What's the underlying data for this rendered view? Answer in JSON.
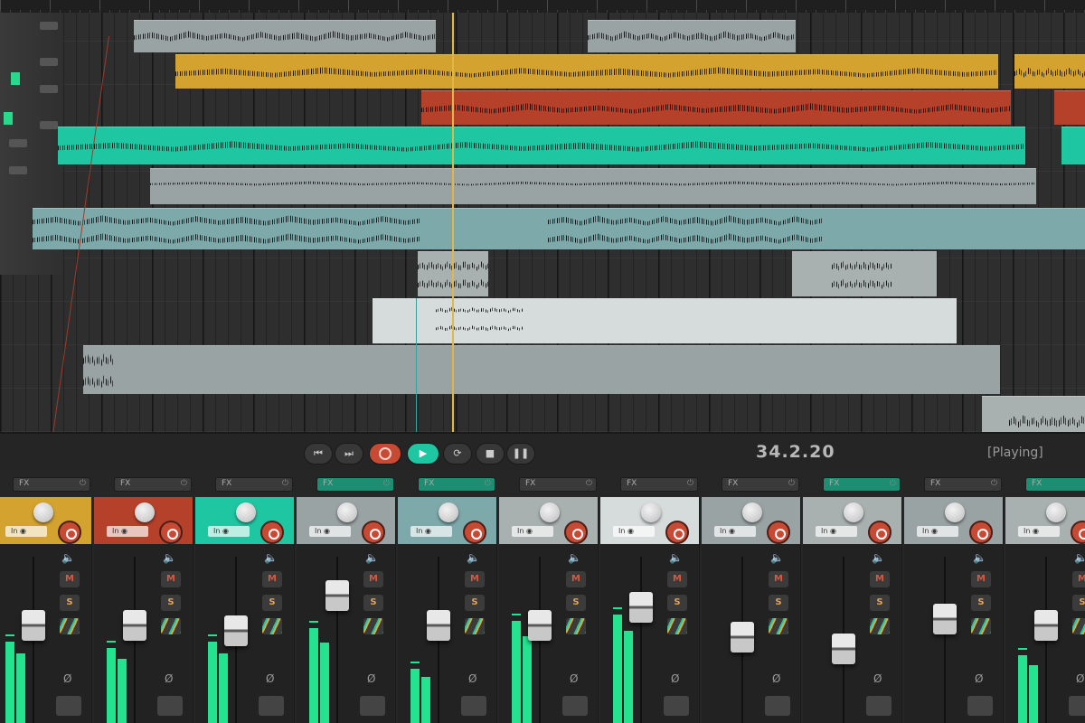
{
  "transport": {
    "time": "34.2.20",
    "state": "[Playing]",
    "icons": [
      "skip-back-icon",
      "skip-forward-icon",
      "record-icon",
      "play-icon",
      "loop-icon",
      "stop-icon",
      "pause-icon"
    ]
  },
  "colors": {
    "accent_teal": "#1fc6a2",
    "record_red": "#c74a35",
    "meter_green": "#23e38f",
    "clip_gold": "#d4a32f",
    "clip_rust": "#b5412a"
  },
  "mixer": {
    "fx_label": "FX",
    "in_label": "In",
    "mute_label": "M",
    "solo_label": "S",
    "phase_label": "Ø",
    "channels": [
      {
        "color": "#d4a32f",
        "fx_on": false,
        "fader": 0.55,
        "meter": 0.6
      },
      {
        "color": "#b5412a",
        "fx_on": false,
        "fader": 0.55,
        "meter": 0.55
      },
      {
        "color": "#1fc6a2",
        "fx_on": false,
        "fader": 0.5,
        "meter": 0.6
      },
      {
        "color": "#9aa3a3",
        "fx_on": true,
        "fader": 0.8,
        "meter": 0.7
      },
      {
        "color": "#7ea9ab",
        "fx_on": true,
        "fader": 0.55,
        "meter": 0.4
      },
      {
        "color": "#a9b0b0",
        "fx_on": false,
        "fader": 0.55,
        "meter": 0.75
      },
      {
        "color": "#d6dbdb",
        "fx_on": false,
        "fader": 0.7,
        "meter": 0.8
      },
      {
        "color": "#9aa3a3",
        "fx_on": false,
        "fader": 0.45,
        "meter": 0.0
      },
      {
        "color": "#a9b0b0",
        "fx_on": true,
        "fader": 0.35,
        "meter": 0.0
      },
      {
        "color": "#9aa3a3",
        "fx_on": false,
        "fader": 0.6,
        "meter": 0.0
      },
      {
        "color": "#a9b0b0",
        "fx_on": true,
        "fader": 0.55,
        "meter": 0.5
      }
    ]
  }
}
